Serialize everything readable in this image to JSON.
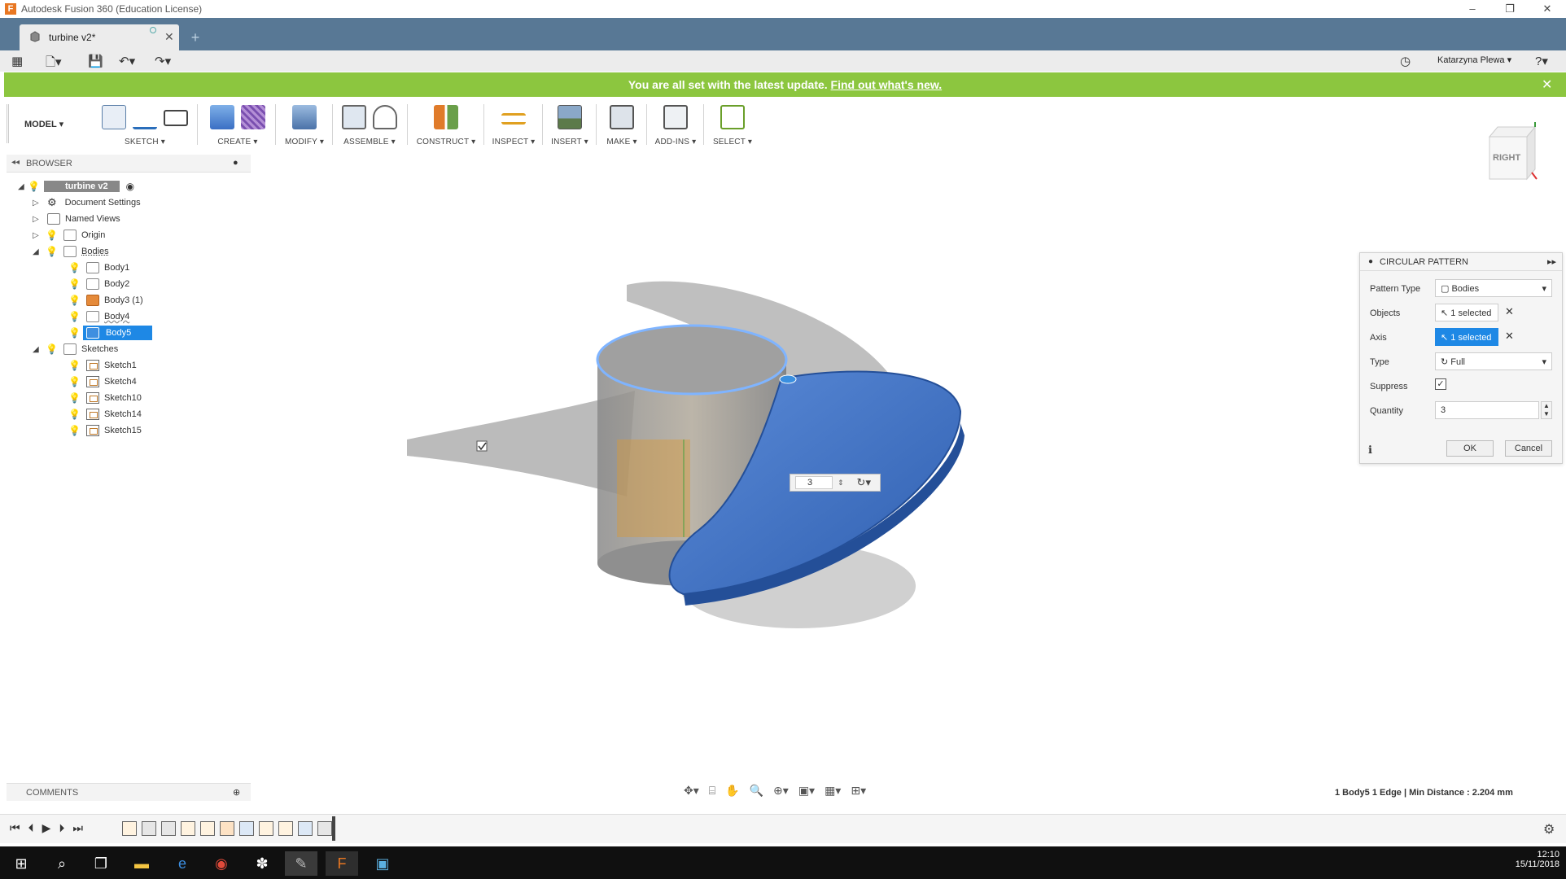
{
  "window": {
    "title": "Autodesk Fusion 360 (Education License)",
    "min": "–",
    "restore": "❐",
    "close": "✕"
  },
  "tabs": [
    {
      "label": "turbine v2*"
    }
  ],
  "user": {
    "name": "Katarzyna Plewa ▾"
  },
  "banner": {
    "text": "You are all set with the latest update.",
    "link": "Find out what's new."
  },
  "ribbon": {
    "workspace": "MODEL",
    "groups": [
      "SKETCH",
      "CREATE",
      "MODIFY",
      "ASSEMBLE",
      "CONSTRUCT",
      "INSPECT",
      "INSERT",
      "MAKE",
      "ADD-INS",
      "SELECT"
    ]
  },
  "viewcube": {
    "face": "RIGHT"
  },
  "browser": {
    "header": "BROWSER",
    "root": "turbine v2",
    "items": [
      {
        "label": "Document Settings"
      },
      {
        "label": "Named Views"
      },
      {
        "label": "Origin"
      },
      {
        "label": "Bodies"
      },
      {
        "label": "Body1"
      },
      {
        "label": "Body2"
      },
      {
        "label": "Body3 (1)"
      },
      {
        "label": "Body4"
      },
      {
        "label": "Body5"
      },
      {
        "label": "Sketches"
      },
      {
        "label": "Sketch1"
      },
      {
        "label": "Sketch4"
      },
      {
        "label": "Sketch10"
      },
      {
        "label": "Sketch14"
      },
      {
        "label": "Sketch15"
      }
    ]
  },
  "comments": {
    "label": "COMMENTS"
  },
  "dialog": {
    "title": "CIRCULAR PATTERN",
    "pattern_type_label": "Pattern Type",
    "pattern_type_value": "Bodies",
    "objects_label": "Objects",
    "objects_value": "1 selected",
    "axis_label": "Axis",
    "axis_value": "1 selected",
    "type_label": "Type",
    "type_value": "Full",
    "suppress_label": "Suppress",
    "quantity_label": "Quantity",
    "quantity_value": "3",
    "ok": "OK",
    "cancel": "Cancel"
  },
  "viewport": {
    "quantity_chip": "3"
  },
  "status": {
    "text": "1 Body5 1 Edge | Min Distance : 2.204 mm"
  },
  "taskbar": {
    "time": "12:10",
    "date": "15/11/2018"
  },
  "colors": {
    "accent": "#1e88e5",
    "banner": "#8cc63f",
    "tabbar": "#587895",
    "body_blue": "#3a6fc4"
  }
}
